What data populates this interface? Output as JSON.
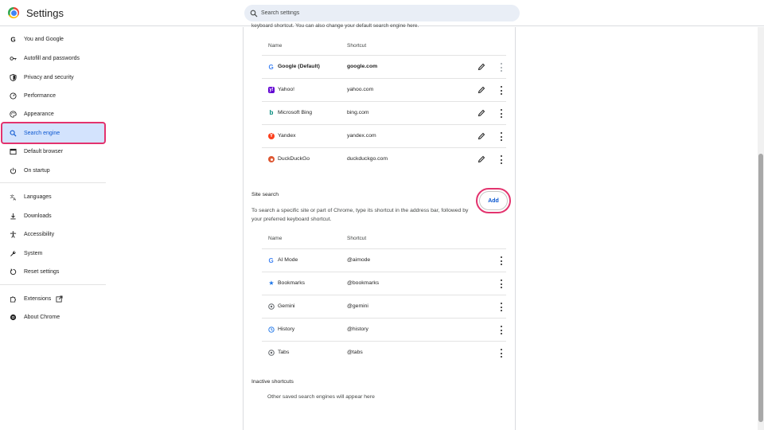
{
  "header": {
    "title": "Settings",
    "search_placeholder": "Search settings"
  },
  "sidebar": {
    "items": [
      {
        "label": "You and Google",
        "icon": "google-g-icon"
      },
      {
        "label": "Autofill and passwords",
        "icon": "key-icon"
      },
      {
        "label": "Privacy and security",
        "icon": "shield-icon"
      },
      {
        "label": "Performance",
        "icon": "speedometer-icon"
      },
      {
        "label": "Appearance",
        "icon": "palette-icon"
      },
      {
        "label": "Search engine",
        "icon": "search-icon",
        "active": true
      },
      {
        "label": "Default browser",
        "icon": "browser-window-icon"
      },
      {
        "label": "On startup",
        "icon": "power-icon"
      },
      {
        "label": "Languages",
        "icon": "translate-icon"
      },
      {
        "label": "Downloads",
        "icon": "download-icon"
      },
      {
        "label": "Accessibility",
        "icon": "accessibility-icon"
      },
      {
        "label": "System",
        "icon": "wrench-icon"
      },
      {
        "label": "Reset settings",
        "icon": "reset-icon"
      },
      {
        "label": "Extensions",
        "icon": "puzzle-icon"
      },
      {
        "label": "About Chrome",
        "icon": "chrome-icon"
      }
    ]
  },
  "main": {
    "intro": "keyboard shortcut. You can also change your default search engine here.",
    "search_engines": {
      "columns": {
        "name": "Name",
        "shortcut": "Shortcut"
      },
      "rows": [
        {
          "name": "Google (Default)",
          "shortcut": "google.com",
          "icon": "google-icon"
        },
        {
          "name": "Yahoo!",
          "shortcut": "yahoo.com",
          "icon": "yahoo-icon"
        },
        {
          "name": "Microsoft Bing",
          "shortcut": "bing.com",
          "icon": "bing-icon"
        },
        {
          "name": "Yandex",
          "shortcut": "yandex.com",
          "icon": "yandex-icon"
        },
        {
          "name": "DuckDuckGo",
          "shortcut": "duckduckgo.com",
          "icon": "duckduckgo-icon"
        }
      ]
    },
    "site_search": {
      "title": "Site search",
      "description": "To search a specific site or part of Chrome, type its shortcut in the address bar, followed by your preferred keyboard shortcut.",
      "add_label": "Add",
      "columns": {
        "name": "Name",
        "shortcut": "Shortcut"
      },
      "rows": [
        {
          "name": "AI Mode",
          "shortcut": "@aimode",
          "icon": "google-icon"
        },
        {
          "name": "Bookmarks",
          "shortcut": "@bookmarks",
          "icon": "star-icon"
        },
        {
          "name": "Gemini",
          "shortcut": "@gemini",
          "icon": "gemini-icon"
        },
        {
          "name": "History",
          "shortcut": "@history",
          "icon": "history-icon"
        },
        {
          "name": "Tabs",
          "shortcut": "@tabs",
          "icon": "tabs-icon"
        }
      ]
    },
    "inactive": {
      "title": "Inactive shortcuts",
      "empty": "Other saved search engines will appear here"
    }
  },
  "colors": {
    "accent": "#0b57d0",
    "active_bg": "#d3e3fd",
    "highlight": "#e3336e"
  }
}
